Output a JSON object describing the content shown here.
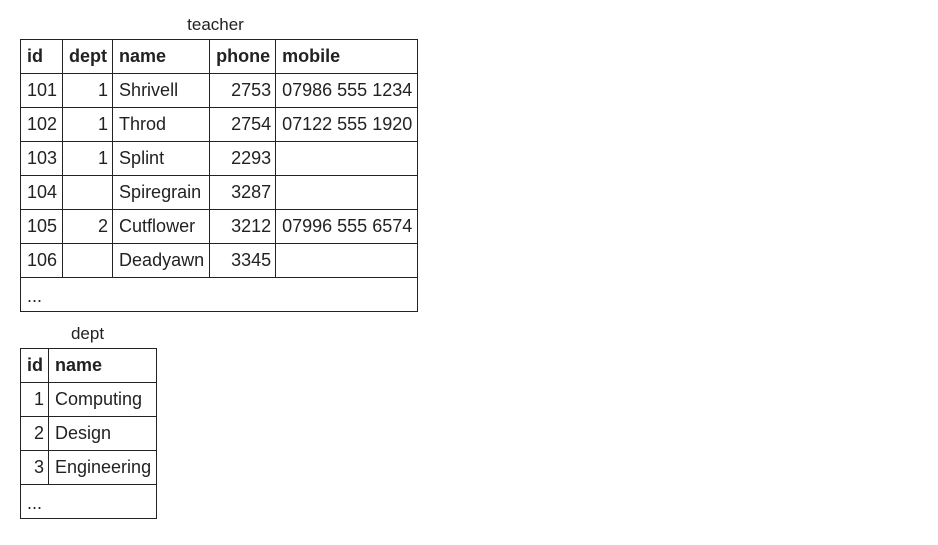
{
  "teacher": {
    "caption": "teacher",
    "headers": {
      "id": "id",
      "dept": "dept",
      "name": "name",
      "phone": "phone",
      "mobile": "mobile"
    },
    "rows": [
      {
        "id": "101",
        "dept": "1",
        "name": "Shrivell",
        "phone": "2753",
        "mobile": "07986 555 1234"
      },
      {
        "id": "102",
        "dept": "1",
        "name": "Throd",
        "phone": "2754",
        "mobile": "07122 555 1920"
      },
      {
        "id": "103",
        "dept": "1",
        "name": "Splint",
        "phone": "2293",
        "mobile": ""
      },
      {
        "id": "104",
        "dept": "",
        "name": "Spiregrain",
        "phone": "3287",
        "mobile": ""
      },
      {
        "id": "105",
        "dept": "2",
        "name": "Cutflower",
        "phone": "3212",
        "mobile": "07996 555 6574"
      },
      {
        "id": "106",
        "dept": "",
        "name": "Deadyawn",
        "phone": "3345",
        "mobile": ""
      }
    ],
    "more": "..."
  },
  "dept": {
    "caption": "dept",
    "headers": {
      "id": "id",
      "name": "name"
    },
    "rows": [
      {
        "id": "1",
        "name": "Computing"
      },
      {
        "id": "2",
        "name": "Design"
      },
      {
        "id": "3",
        "name": "Engineering"
      }
    ],
    "more": "..."
  }
}
